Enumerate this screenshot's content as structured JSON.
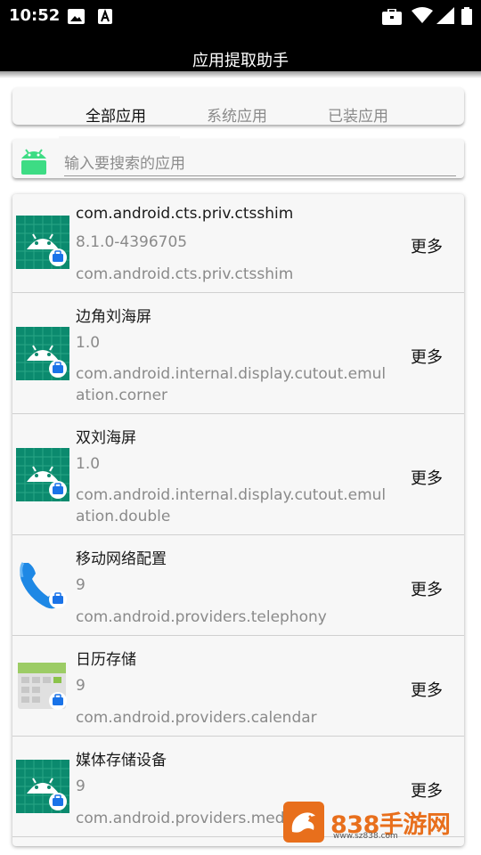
{
  "status_bar": {
    "time": "10:52",
    "icons": [
      "image-icon",
      "text-a-icon",
      "briefcase-icon",
      "wifi-icon",
      "signal-icon",
      "battery-icon"
    ]
  },
  "app_bar": {
    "title": "应用提取助手"
  },
  "tabs": [
    {
      "label": "全部应用",
      "active": true
    },
    {
      "label": "系统应用",
      "active": false
    },
    {
      "label": "已装应用",
      "active": false
    }
  ],
  "search": {
    "placeholder": "输入要搜索的应用",
    "value": ""
  },
  "apps": [
    {
      "name": "com.android.cts.priv.ctsshim",
      "version": "8.1.0-4396705",
      "package": "com.android.cts.priv.ctsshim",
      "more_label": "更多",
      "icon": "android-icon"
    },
    {
      "name": "边角刘海屏",
      "version": "1.0",
      "package": "com.android.internal.display.cutout.emulation.corner",
      "more_label": "更多",
      "icon": "android-icon"
    },
    {
      "name": "双刘海屏",
      "version": "1.0",
      "package": "com.android.internal.display.cutout.emulation.double",
      "more_label": "更多",
      "icon": "android-icon"
    },
    {
      "name": "移动网络配置",
      "version": "9",
      "package": "com.android.providers.telephony",
      "more_label": "更多",
      "icon": "phone-icon"
    },
    {
      "name": "日历存储",
      "version": "9",
      "package": "com.android.providers.calendar",
      "more_label": "更多",
      "icon": "calendar-icon"
    },
    {
      "name": "媒体存储设备",
      "version": "9",
      "package": "com.android.providers.media",
      "more_label": "更多",
      "icon": "android-icon"
    }
  ],
  "watermark": {
    "text": "838手游网",
    "url": "www.sz838.com"
  },
  "colors": {
    "accent_green": "#3ddc84",
    "icon_teal": "#0b8a6e",
    "work_badge": "#1a73e8",
    "watermark_orange": "#e86f1c"
  }
}
